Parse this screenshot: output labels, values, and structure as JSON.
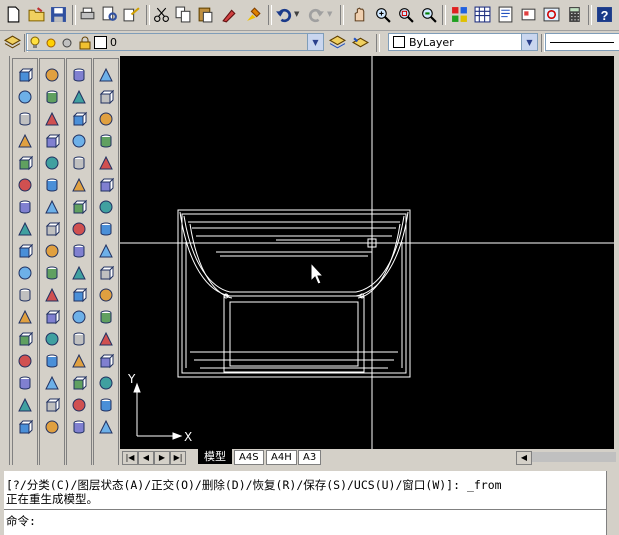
{
  "toolbar": {
    "icons": [
      "new-icon",
      "open-icon",
      "save-icon",
      "print-icon",
      "preview-icon",
      "publish-icon",
      "cut-icon",
      "copy-icon",
      "paste-icon",
      "match-properties-icon",
      "block-editor-icon",
      "undo-icon",
      "redo-icon",
      "pan-icon",
      "zoom-realtime-icon",
      "zoom-window-icon",
      "zoom-previous-icon",
      "properties-icon",
      "design-center-icon",
      "tool-palettes-icon",
      "sheet-set-icon",
      "markup-icon",
      "calculator-icon",
      "help-icon"
    ]
  },
  "layers": {
    "current_layer": "0",
    "color": "ByLayer"
  },
  "canvas": {
    "ucs_x_label": "X",
    "ucs_y_label": "Y",
    "background": "#000000",
    "line_color": "#ffffff"
  },
  "tabs": [
    {
      "label": "模型",
      "active": true
    },
    {
      "label": "A4S",
      "active": false
    },
    {
      "label": "A4H",
      "active": false
    },
    {
      "label": "A3",
      "active": false
    }
  ],
  "command": {
    "history_line_1": "[?/分类(C)/图层状态(A)/正交(O)/删除(D)/恢复(R)/保存(S)/UCS(U)/窗口(W)]: _from",
    "history_line_2": "正在重生成模型。",
    "prompt": "命令:"
  }
}
